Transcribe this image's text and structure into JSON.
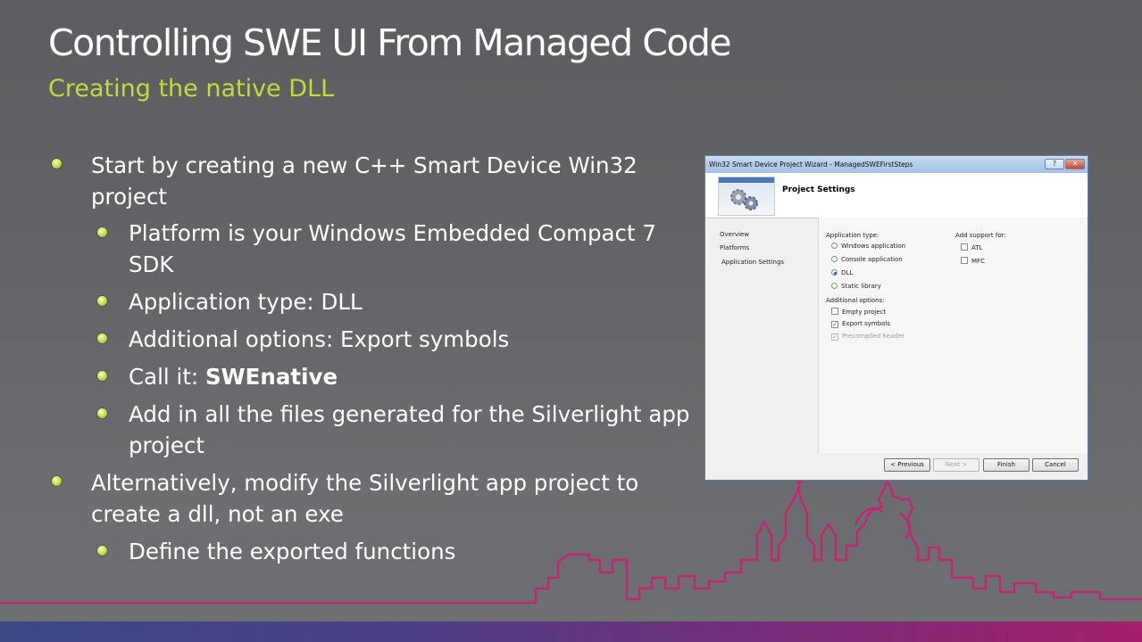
{
  "slide": {
    "title": "Controlling SWE UI From Managed Code",
    "subtitle": "Creating the native DLL",
    "bullets": {
      "b1": "Start by creating a new C++ Smart Device Win32 project",
      "b1_1": "Platform is your Windows Embedded Compact 7 SDK",
      "b1_2": "Application type: DLL",
      "b1_3": "Additional options: Export symbols",
      "b1_4_prefix": "Call it: ",
      "b1_4_bold": "SWEnative",
      "b1_5": "Add in all the files generated for the Silverlight app project",
      "b2": "Alternatively, modify the Silverlight app project to create a dll, not an exe",
      "b2_1": "Define the exported functions"
    }
  },
  "dialog": {
    "window_title": "Win32 Smart Device Project Wizard - ManagedSWEFirstSteps",
    "help_label": "?",
    "close_label": "✕",
    "header_title": "Project Settings",
    "nav": {
      "overview": "Overview",
      "platforms": "Platforms",
      "app_settings": "Application Settings"
    },
    "app_type": {
      "label": "Application type:",
      "windows_app": "Windows application",
      "console_app": "Console application",
      "dll": "DLL",
      "static_lib": "Static library",
      "selected": "DLL"
    },
    "additional": {
      "label": "Additional options:",
      "empty_project": "Empty project",
      "export_symbols": "Export symbols",
      "precompiled_header": "Precompiled header",
      "empty_checked": false,
      "export_checked": true,
      "precompiled_checked": true
    },
    "support": {
      "label": "Add support for:",
      "atl": "ATL",
      "mfc": "MFC"
    },
    "buttons": {
      "previous": "< Previous",
      "next": "Next >",
      "finish": "Finish",
      "cancel": "Cancel"
    },
    "check_mark": "✓"
  },
  "colors": {
    "subtitle": "#c6d93a",
    "skyline": "#c2286f",
    "bullet": "#cde25a"
  }
}
